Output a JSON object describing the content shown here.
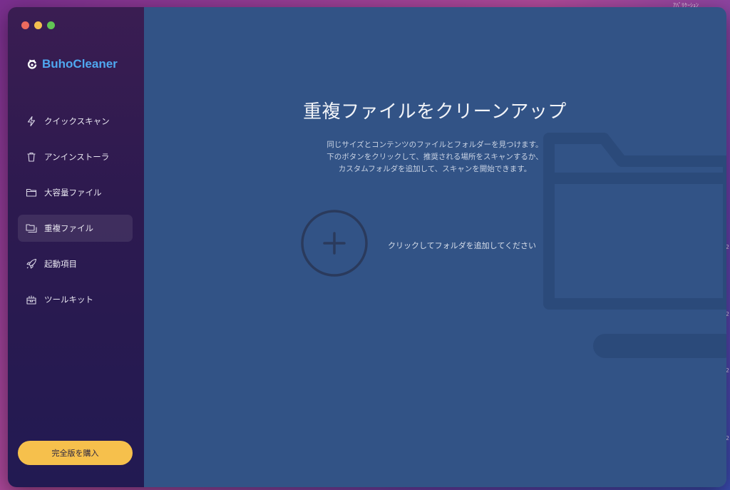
{
  "desktop": {
    "top_right_text": "ｱﾊﾟﾘｹｰｼｮﾝ",
    "right_edge_numbers": [
      "2",
      "2",
      "2",
      "2"
    ]
  },
  "window": {
    "traffic_lights": {
      "close": "#ed6a5e",
      "minimize": "#f4bf4f",
      "zoom": "#61c554"
    }
  },
  "sidebar": {
    "brand": {
      "name": "BuhoCleaner",
      "logo_icon": "buho-logo-icon",
      "color": "#4fa8f0"
    },
    "items": [
      {
        "label": "クイックスキャン",
        "icon": "lightning-icon",
        "active": false
      },
      {
        "label": "アンインストーラ",
        "icon": "trash-icon",
        "active": false
      },
      {
        "label": "大容量ファイル",
        "icon": "folder-icon",
        "active": false
      },
      {
        "label": "重複ファイル",
        "icon": "duplicate-folder-icon",
        "active": true
      },
      {
        "label": "起動項目",
        "icon": "rocket-icon",
        "active": false
      },
      {
        "label": "ツールキット",
        "icon": "toolkit-icon",
        "active": false
      }
    ],
    "buy_button": {
      "label": "完全版を購入",
      "color": "#f6c04c"
    }
  },
  "main": {
    "title": "重複ファイルをクリーンアップ",
    "description": [
      "同じサイズとコンテンツのファイルとフォルダーを見つけます。",
      "下のボタンをクリックして、推奨される場所をスキャンするか、",
      "カスタムフォルダを追加して、スキャンを開始できます。"
    ],
    "add_folder": {
      "label": "クリックしてフォルダを追加してください",
      "icon": "plus-circle-icon"
    },
    "background_color": "#325386"
  }
}
